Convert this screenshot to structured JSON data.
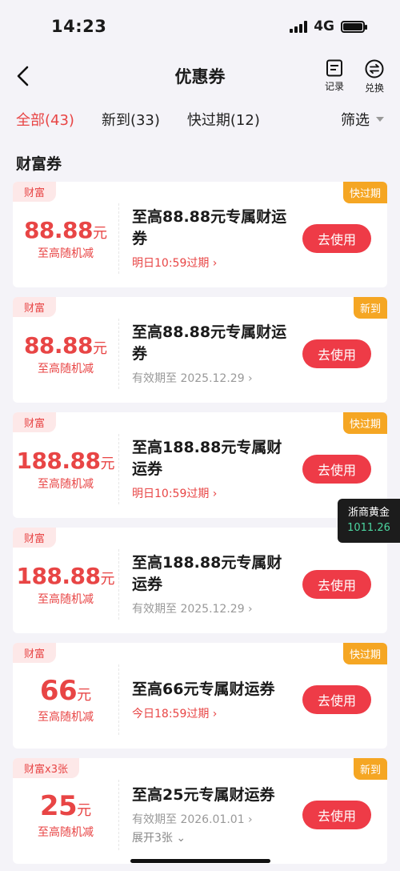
{
  "status": {
    "time": "14:23",
    "network": "4G"
  },
  "nav": {
    "title": "优惠券",
    "record_label": "记录",
    "exchange_label": "兑换"
  },
  "tabs": [
    {
      "label": "全部(43)",
      "active": true
    },
    {
      "label": "新到(33)"
    },
    {
      "label": "快过期(12)"
    }
  ],
  "filter_label": "筛选",
  "section_title": "财富券",
  "coupons": [
    {
      "tag": "财富",
      "badge": "快过期",
      "amount": "88.88",
      "unit": "元",
      "sub": "至高随机减",
      "title": "至高88.88元专属财运券",
      "expiry": "明日10:59过期 ›",
      "button": "去使用"
    },
    {
      "tag": "财富",
      "badge": "新到",
      "amount": "88.88",
      "unit": "元",
      "sub": "至高随机减",
      "title": "至高88.88元专属财运券",
      "expiry": "有效期至 2025.12.29 ›",
      "button": "去使用"
    },
    {
      "tag": "财富",
      "badge": "快过期",
      "amount": "188.88",
      "unit": "元",
      "sub": "至高随机减",
      "title": "至高188.88元专属财运券",
      "expiry": "明日10:59过期 ›",
      "button": "去使用"
    },
    {
      "tag": "财富",
      "badge": "",
      "amount": "188.88",
      "unit": "元",
      "sub": "至高随机减",
      "title": "至高188.88元专属财运券",
      "expiry": "有效期至 2025.12.29 ›",
      "button": "去使用"
    },
    {
      "tag": "财富",
      "badge": "快过期",
      "amount": "66",
      "unit": "元",
      "sub": "至高随机减",
      "title": "至高66元专属财运券",
      "expiry": "今日18:59过期 ›",
      "button": "去使用"
    },
    {
      "tag": "财富x3张",
      "badge": "新到",
      "amount": "25",
      "unit": "元",
      "sub": "至高随机减",
      "title": "至高25元专属财运券",
      "expiry": "有效期至 2026.01.01 ›",
      "expand": "展开3张 ⌄",
      "button": "去使用"
    }
  ],
  "gold_widget": {
    "name": "浙商黄金",
    "value": "1011.26"
  },
  "colors": {
    "accent": "#e84545",
    "button": "#ee3b47",
    "badge": "#f5a623"
  }
}
